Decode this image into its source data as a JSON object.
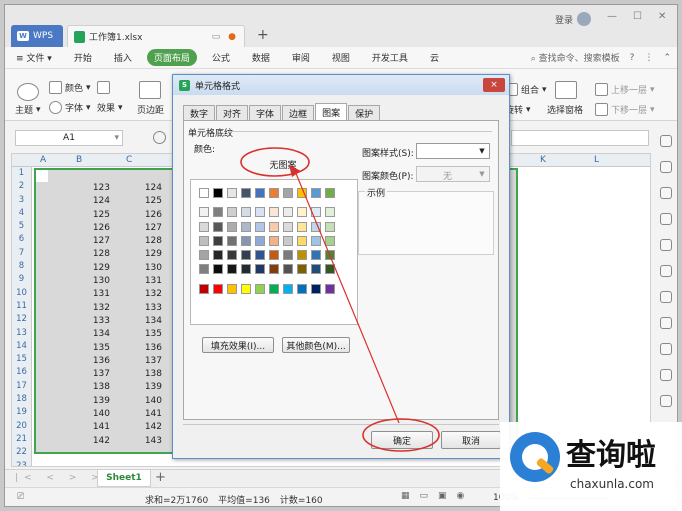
{
  "titlebar": {
    "wps_tab": "WPS",
    "doc_tab": "工作簿1.xlsx",
    "new_tab": "+",
    "login": "登录"
  },
  "menu": {
    "file": "文件",
    "items": [
      "开始",
      "插入",
      "页面布局",
      "公式",
      "数据",
      "审阅",
      "视图",
      "开发工具",
      "云"
    ],
    "search": "查找命令、搜索模板",
    "help": "?"
  },
  "ribbon": {
    "theme": "主题",
    "colors": "颜色",
    "fonts": "字体",
    "effects": "效果",
    "margin": "页边距",
    "combine": "组合",
    "rotate": "旋转",
    "select_pane": "选择窗格",
    "up_one": "上移一层",
    "down_one": "下移一层"
  },
  "formula_bar": {
    "cell_ref": "A1"
  },
  "grid": {
    "col_headers": [
      "A",
      "B",
      "C"
    ],
    "col_k": "K",
    "col_l": "L",
    "row_numbers": [
      "1",
      "2",
      "3",
      "4",
      "5",
      "6",
      "7",
      "8",
      "9",
      "10",
      "11",
      "12",
      "13",
      "14",
      "15",
      "16",
      "17",
      "18",
      "19",
      "20",
      "21",
      "22",
      "23"
    ],
    "col_b": [
      "123",
      "124",
      "125",
      "126",
      "127",
      "128",
      "129",
      "130",
      "131",
      "132",
      "133",
      "134",
      "135",
      "136",
      "137",
      "138",
      "139",
      "140",
      "141",
      "142"
    ],
    "col_c": [
      "124",
      "125",
      "126",
      "127",
      "128",
      "129",
      "130",
      "131",
      "132",
      "133",
      "134",
      "135",
      "136",
      "137",
      "138",
      "139",
      "140",
      "141",
      "142",
      "143"
    ]
  },
  "sheets": {
    "active": "Sheet1",
    "add": "+"
  },
  "status": {
    "sum": "求和=2万1760",
    "average": "平均值=136",
    "count": "计数=160",
    "zoom": "100%"
  },
  "dialog": {
    "title": "单元格格式",
    "close": "×",
    "tabs": [
      "数字",
      "对齐",
      "字体",
      "边框",
      "图案",
      "保护"
    ],
    "active_tab": "图案",
    "section": "单元格底纹",
    "color_label": "颜色:",
    "no_pattern": "无图案",
    "fill_effects": "填充效果(I)...",
    "more_colors": "其他颜色(M)...",
    "pattern_style_label": "图案样式(S):",
    "pattern_color_label": "图案颜色(P):",
    "pattern_color_value": "无",
    "sample_label": "示例",
    "ok": "确定",
    "cancel": "取消"
  },
  "palette": {
    "rows": [
      [
        "#ffffff",
        "#000000",
        "#e7e6e6",
        "#44546a",
        "#4472c4",
        "#ed7d31",
        "#a5a5a5",
        "#ffc000",
        "#5b9bd5",
        "#70ad47"
      ],
      [
        "#f2f2f2",
        "#7f7f7f",
        "#d0cece",
        "#d6dce4",
        "#d9e2f3",
        "#fbe5d5",
        "#ededed",
        "#fff2cc",
        "#deebf6",
        "#e2efd9"
      ],
      [
        "#d9d9d9",
        "#595959",
        "#aeabab",
        "#adb9ca",
        "#b4c6e7",
        "#f7cbac",
        "#dbdbdb",
        "#fee599",
        "#bdd7ee",
        "#c5e0b3"
      ],
      [
        "#bfbfbf",
        "#3f3f3f",
        "#757070",
        "#8496b0",
        "#8eaadb",
        "#f4b183",
        "#c9c9c9",
        "#ffd965",
        "#9dc3e6",
        "#a8d08d"
      ],
      [
        "#a5a5a5",
        "#262626",
        "#3a3838",
        "#323f4f",
        "#2f5496",
        "#c55a11",
        "#7b7b7b",
        "#bf9000",
        "#2e75b5",
        "#538135"
      ],
      [
        "#7f7f7f",
        "#0c0c0c",
        "#171616",
        "#222a35",
        "#1f3864",
        "#833c0b",
        "#525252",
        "#7f6000",
        "#1e4e79",
        "#375623"
      ],
      [
        "#c00000",
        "#ff0000",
        "#ffc000",
        "#ffff00",
        "#92d050",
        "#00b050",
        "#00b0f0",
        "#0070c0",
        "#002060",
        "#7030a0"
      ]
    ]
  },
  "watermark": {
    "brand": "查询啦",
    "url": "chaxunla.com"
  }
}
